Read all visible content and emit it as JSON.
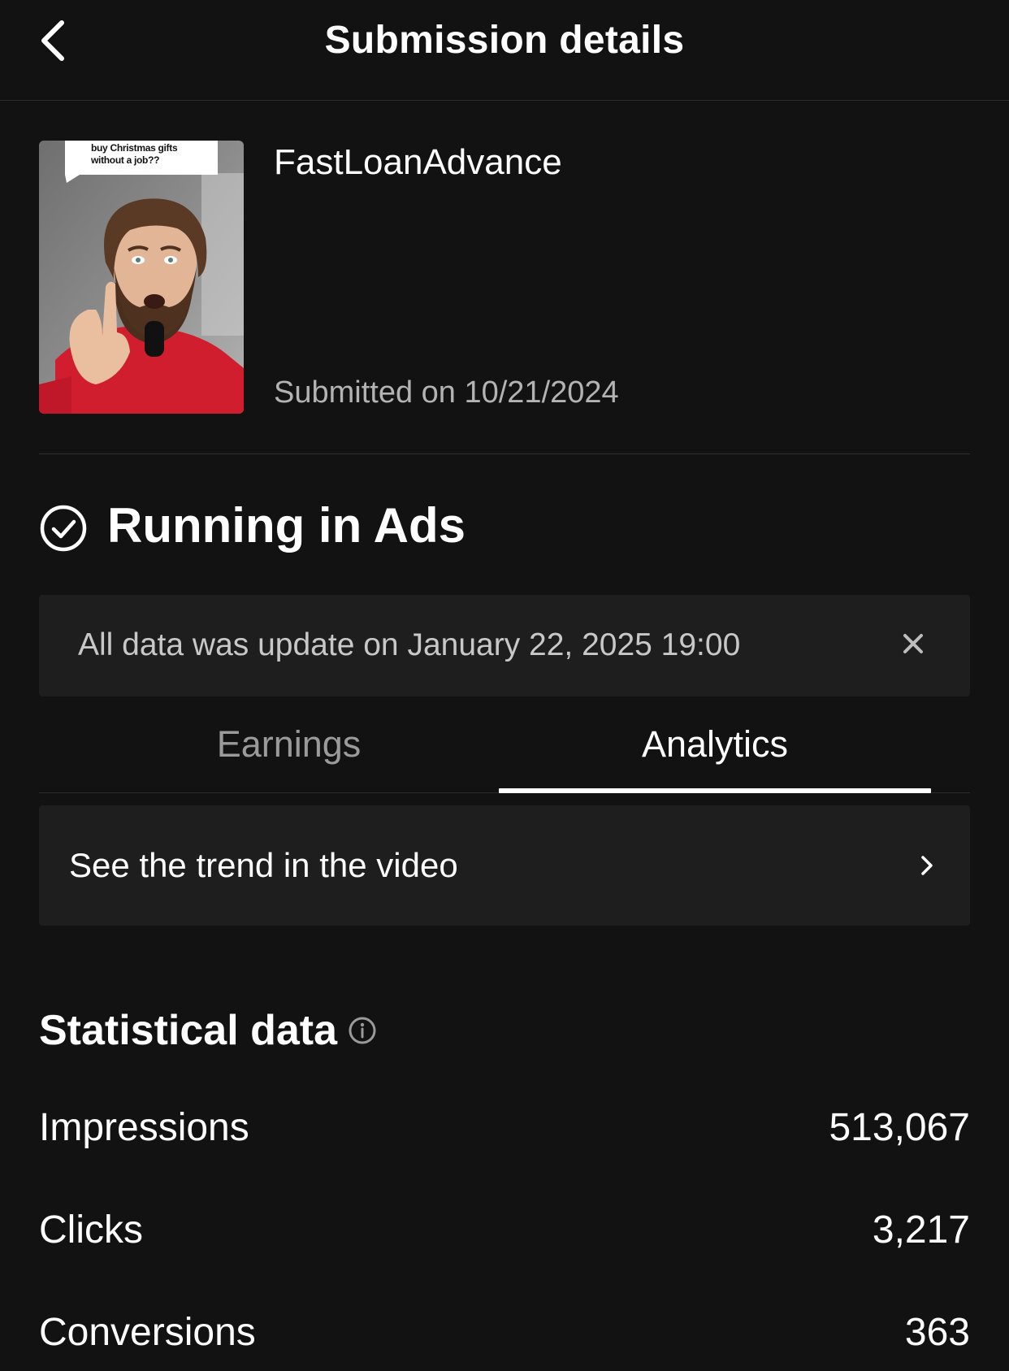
{
  "header": {
    "title": "Submission details",
    "back_icon": "chevron-left-icon"
  },
  "submission": {
    "thumbnail_caption": "buy Christmas gifts without a job??",
    "brand": "FastLoanAdvance",
    "submitted": "Submitted on 10/21/2024"
  },
  "status": {
    "label": "Running in Ads",
    "icon": "check-circle-icon"
  },
  "banner": {
    "text": "All data was update on January 22, 2025 19:00",
    "close_icon": "close-icon"
  },
  "tabs": [
    {
      "label": "Earnings",
      "active": false
    },
    {
      "label": "Analytics",
      "active": true
    }
  ],
  "trend": {
    "label": "See the trend in the video",
    "icon": "chevron-right-icon"
  },
  "stats": {
    "title": "Statistical data",
    "info_icon": "info-icon",
    "rows": [
      {
        "label": "Impressions",
        "value": "513,067"
      },
      {
        "label": "Clicks",
        "value": "3,217"
      },
      {
        "label": "Conversions",
        "value": "363"
      }
    ]
  },
  "colors": {
    "background": "#121212",
    "panel": "#1e1e1e",
    "text_primary": "#ffffff",
    "text_secondary": "#b3b3b3",
    "tab_inactive": "#9a9a9a",
    "thumbnail_hoodie": "#d11e2e"
  }
}
